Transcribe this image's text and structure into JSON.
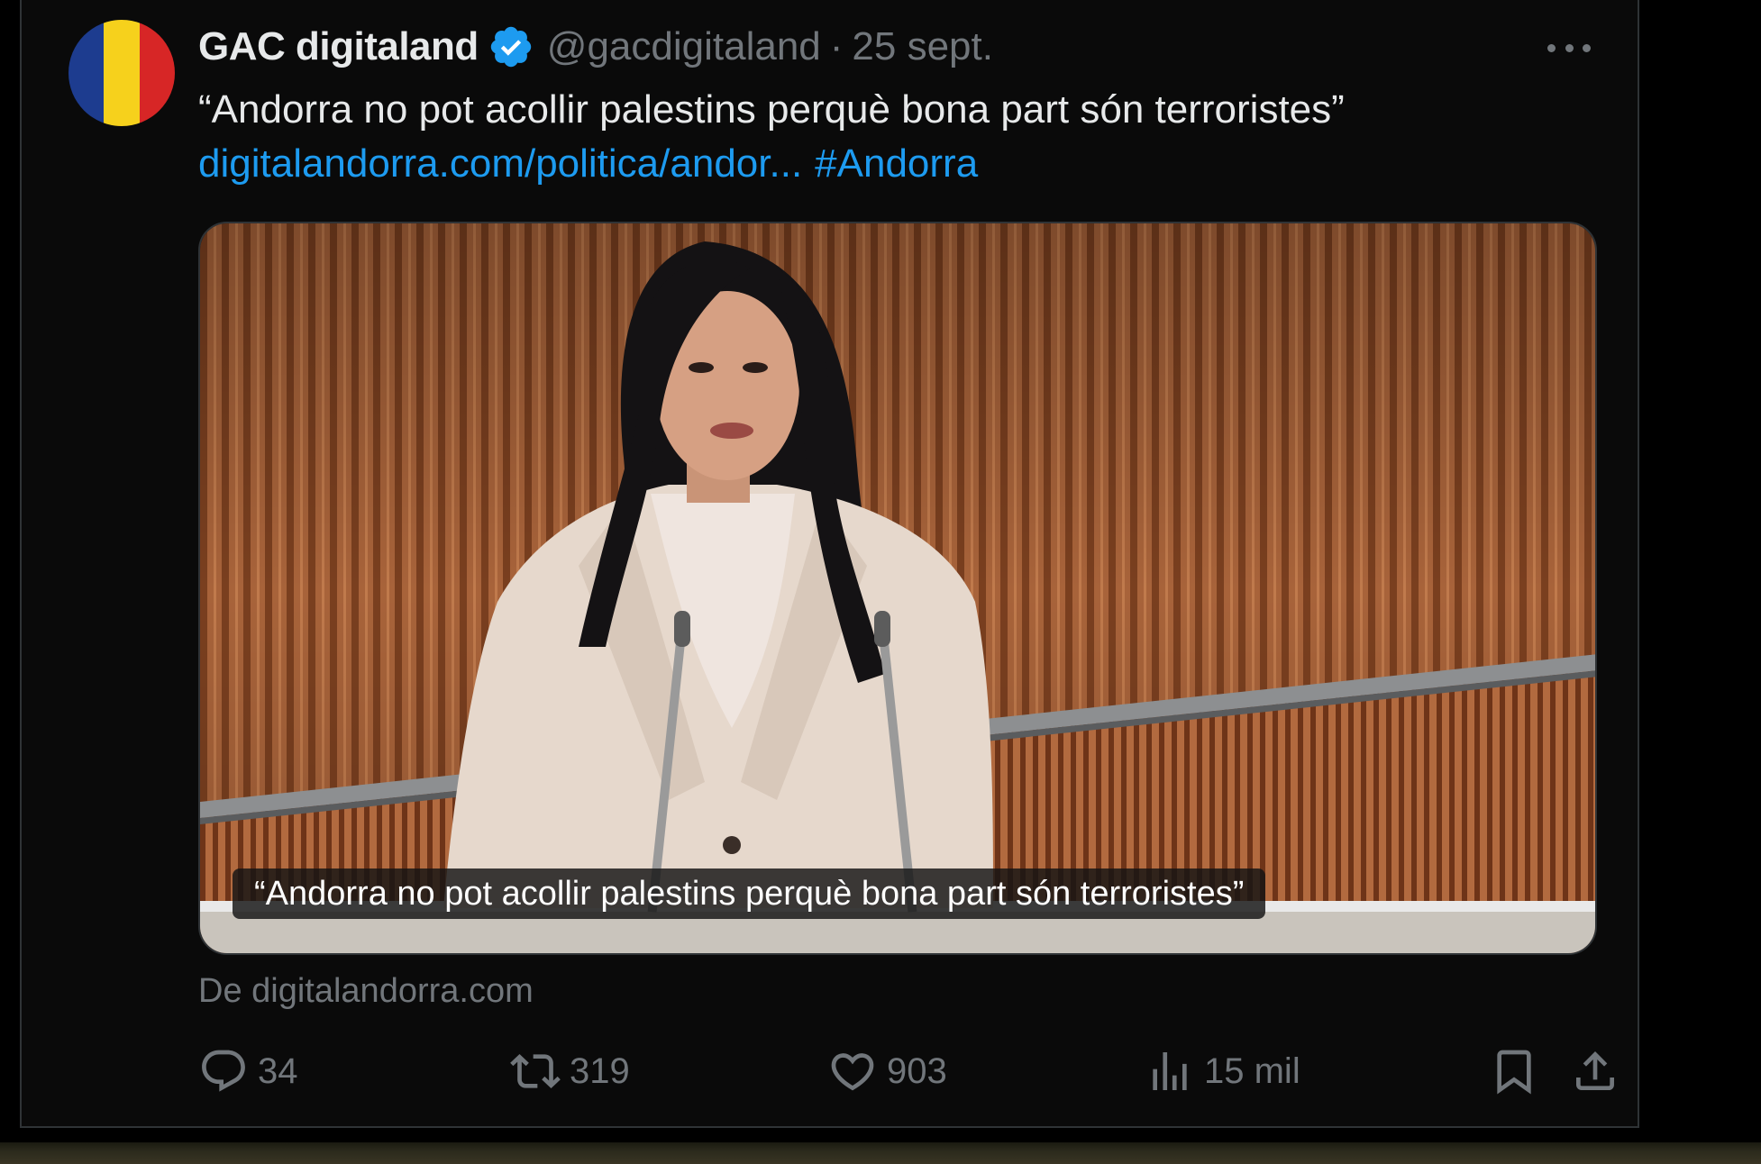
{
  "tweet": {
    "author": {
      "display_name": "GAC digitaland",
      "handle": "@gacdigitaland",
      "verified": true,
      "avatar_flag_colors": [
        "#1d3c8f",
        "#f6d11c",
        "#d72626"
      ]
    },
    "separator": "·",
    "date": "25 sept.",
    "text": "“Andorra no pot acollir palestins perquè bona part són terroristes”",
    "link": "digitalandorra.com/politica/andor...",
    "hashtag": "#Andorra",
    "media": {
      "caption": "“Andorra no pot acollir palestins perquè bona part són terroristes”",
      "source": "De digitalandorra.com"
    },
    "metrics": {
      "replies": "34",
      "retweets": "319",
      "likes": "903",
      "views": "15 mil"
    }
  },
  "icons": {
    "verified": "verified-badge-icon",
    "more": "more-icon",
    "reply": "reply-icon",
    "retweet": "retweet-icon",
    "like": "heart-icon",
    "views": "views-icon",
    "bookmark": "bookmark-icon",
    "share": "share-icon"
  },
  "colors": {
    "background": "#000000",
    "text": "#e7e9ea",
    "secondary": "#71767b",
    "link": "#1d9bf0",
    "border": "#2f3336"
  }
}
